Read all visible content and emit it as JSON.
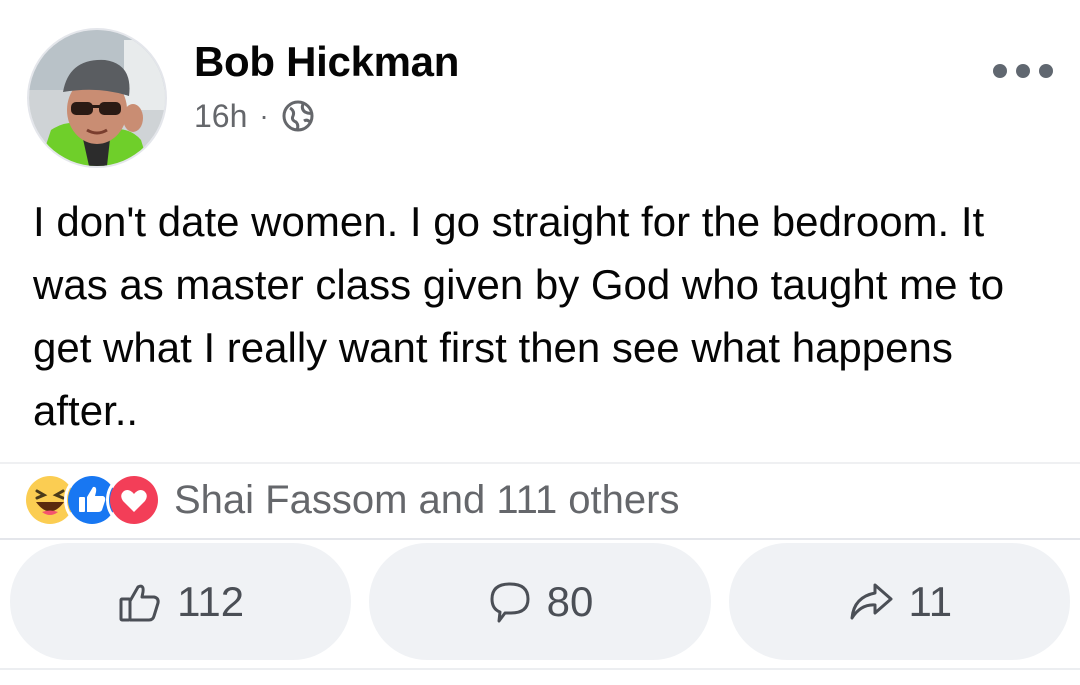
{
  "post": {
    "author": "Bob Hickman",
    "time": "16h",
    "separator": "·",
    "privacy_icon": "globe-icon",
    "menu_icon": "more-dots-icon",
    "text": "I don't date women. I go straight for the bedroom. It was as master class given by God who taught me to get what I really want first then see what happens after.."
  },
  "reactions": {
    "icons": [
      "haha-icon",
      "like-icon",
      "love-icon"
    ],
    "summary": "Shai Fassom and 111 others"
  },
  "actions": {
    "like": {
      "icon": "thumbs-up-icon",
      "count": "112"
    },
    "comment": {
      "icon": "comment-bubble-icon",
      "count": "80"
    },
    "share": {
      "icon": "share-arrow-icon",
      "count": "11"
    }
  },
  "colors": {
    "primary_text": "#050505",
    "secondary_text": "#65676b",
    "button_bg": "#f0f2f5",
    "like_blue": "#1877f2",
    "love_red": "#f33e58",
    "haha_yellow": "#fbcd52"
  }
}
